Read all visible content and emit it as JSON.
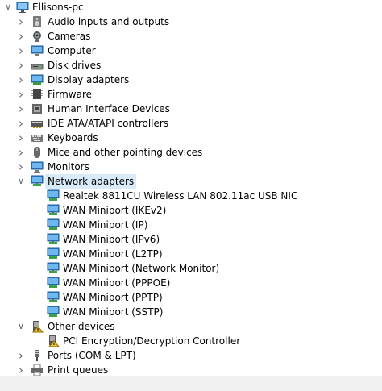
{
  "tree": {
    "root": {
      "label": "Ellisons-pc",
      "icon": "computer-icon",
      "expanded": true
    },
    "categories": [
      {
        "label": "Audio inputs and outputs",
        "icon": "speaker-icon",
        "expanded": false
      },
      {
        "label": "Cameras",
        "icon": "camera-icon",
        "expanded": false
      },
      {
        "label": "Computer",
        "icon": "monitor-icon",
        "expanded": false
      },
      {
        "label": "Disk drives",
        "icon": "disk-drive-icon",
        "expanded": false
      },
      {
        "label": "Display adapters",
        "icon": "display-adapter-icon",
        "expanded": false
      },
      {
        "label": "Firmware",
        "icon": "chip-icon",
        "expanded": false
      },
      {
        "label": "Human Interface Devices",
        "icon": "hid-icon",
        "expanded": false
      },
      {
        "label": "IDE ATA/ATAPI controllers",
        "icon": "ide-controller-icon",
        "expanded": false
      },
      {
        "label": "Keyboards",
        "icon": "keyboard-icon",
        "expanded": false
      },
      {
        "label": "Mice and other pointing devices",
        "icon": "mouse-icon",
        "expanded": false
      },
      {
        "label": "Monitors",
        "icon": "monitor-icon",
        "expanded": false
      },
      {
        "label": "Network adapters",
        "icon": "network-adapter-icon",
        "expanded": true,
        "selected": true,
        "children": [
          "Realtek 8811CU Wireless LAN 802.11ac USB NIC",
          "WAN Miniport (IKEv2)",
          "WAN Miniport (IP)",
          "WAN Miniport (IPv6)",
          "WAN Miniport (L2TP)",
          "WAN Miniport (Network Monitor)",
          "WAN Miniport (PPPOE)",
          "WAN Miniport (PPTP)",
          "WAN Miniport (SSTP)"
        ]
      },
      {
        "label": "Other devices",
        "icon": "unknown-device-icon",
        "expanded": true,
        "children": [
          "PCI Encryption/Decryption Controller"
        ]
      },
      {
        "label": "Ports (COM & LPT)",
        "icon": "port-icon",
        "expanded": false
      },
      {
        "label": "Print queues",
        "icon": "printer-icon",
        "expanded": false
      }
    ]
  },
  "colors": {
    "selection": "#d9ebf9",
    "chevron": "#666666",
    "statusbar": "#f0f0f0"
  }
}
